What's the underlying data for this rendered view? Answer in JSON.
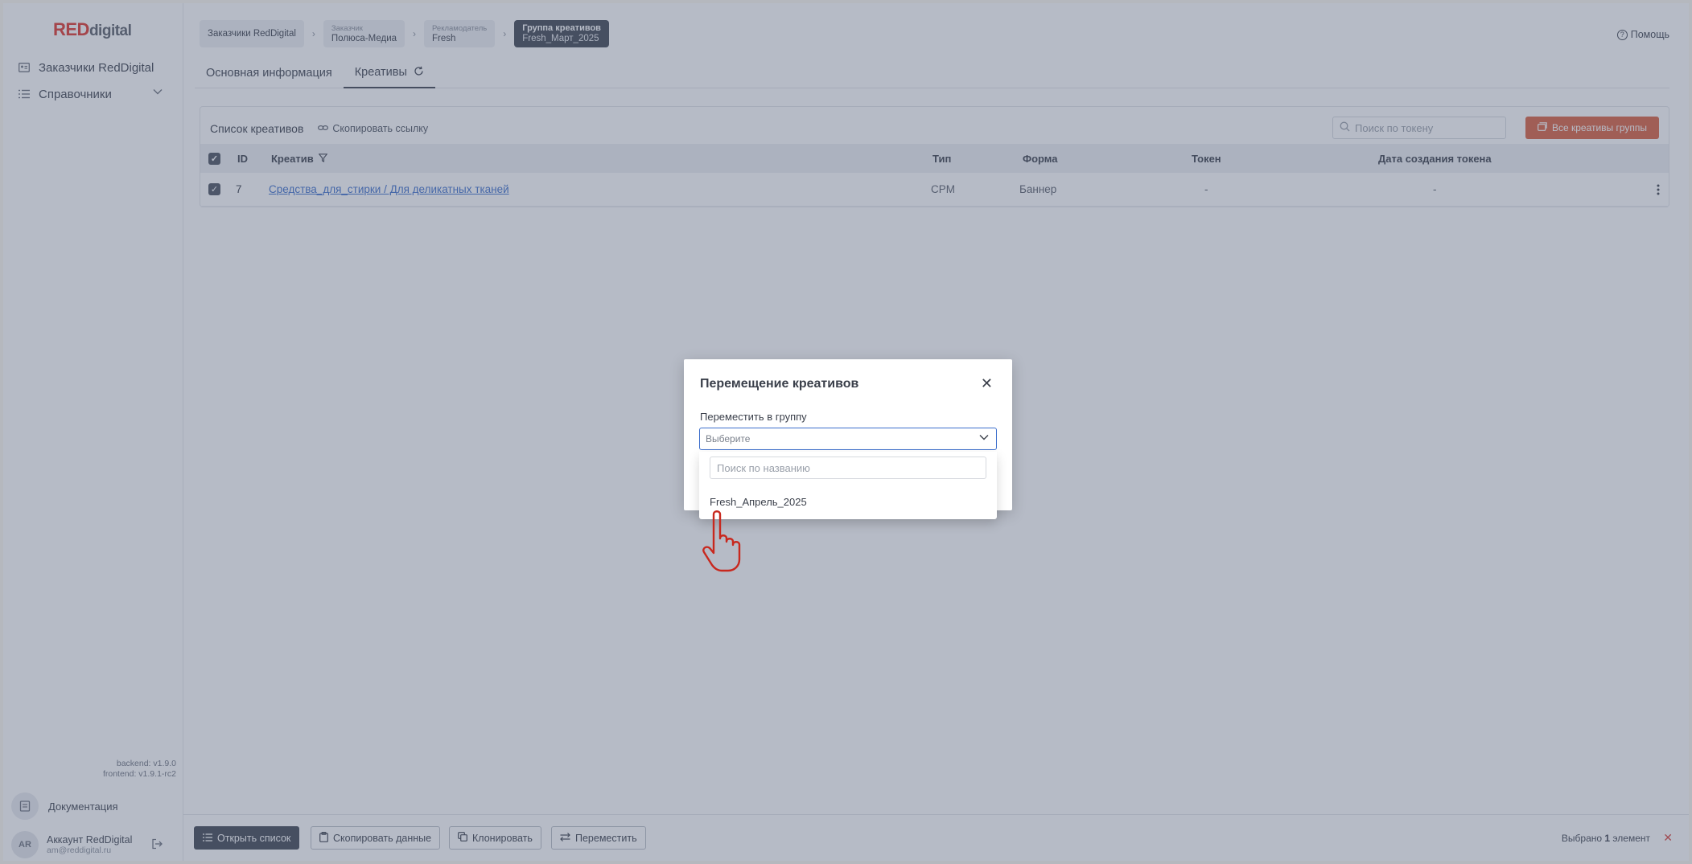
{
  "logo": {
    "red": "RED",
    "rest": "digital"
  },
  "sidebar": {
    "items": [
      {
        "label": "Заказчики RedDigital",
        "icon": "customers-icon"
      },
      {
        "label": "Справочники",
        "icon": "list-icon"
      }
    ],
    "version_backend": "backend: v1.9.0",
    "version_frontend": "frontend: v1.9.1-rc2",
    "docs_label": "Документация",
    "account": {
      "initials": "AR",
      "name": "Аккаунт RedDigital",
      "email": "am@reddigital.ru"
    }
  },
  "breadcrumbs": [
    {
      "label": "",
      "value": "Заказчики RedDigital"
    },
    {
      "label": "Заказчик",
      "value": "Полюса-Медиа"
    },
    {
      "label": "Рекламодатель",
      "value": "Fresh"
    },
    {
      "label": "Группа креативов",
      "value": "Fresh_Март_2025"
    }
  ],
  "help_label": "Помощь",
  "tabs": [
    {
      "label": "Основная информация"
    },
    {
      "label": "Креативы"
    }
  ],
  "list": {
    "title": "Список креативов",
    "copy_link": "Скопировать ссылку",
    "search_placeholder": "Поиск по токену",
    "all_button": "Все креативы группы",
    "columns": {
      "id": "ID",
      "creative": "Креатив",
      "type": "Тип",
      "form": "Форма",
      "token": "Токен",
      "token_date": "Дата создания токена"
    },
    "rows": [
      {
        "id": "7",
        "creative": "Средства_для_стирки / Для деликатных тканей",
        "type": "CPM",
        "form": "Баннер",
        "token": "-",
        "token_date": "-"
      }
    ]
  },
  "bottom_bar": {
    "open_list": "Открыть список",
    "copy_data": "Скопировать данные",
    "clone": "Клонировать",
    "move": "Переместить",
    "selected_prefix": "Выбрано ",
    "selected_count": "1",
    "selected_suffix": " элемент"
  },
  "modal": {
    "title": "Перемещение креативов",
    "field_label": "Переместить в группу",
    "select_placeholder": "Выберите",
    "search_placeholder": "Поиск по названию",
    "options": [
      "Fresh_Апрель_2025"
    ]
  },
  "colors": {
    "accent": "#d9603f",
    "dark": "#3e4552",
    "link": "#3d6fcc",
    "overlay": "#525e76"
  }
}
